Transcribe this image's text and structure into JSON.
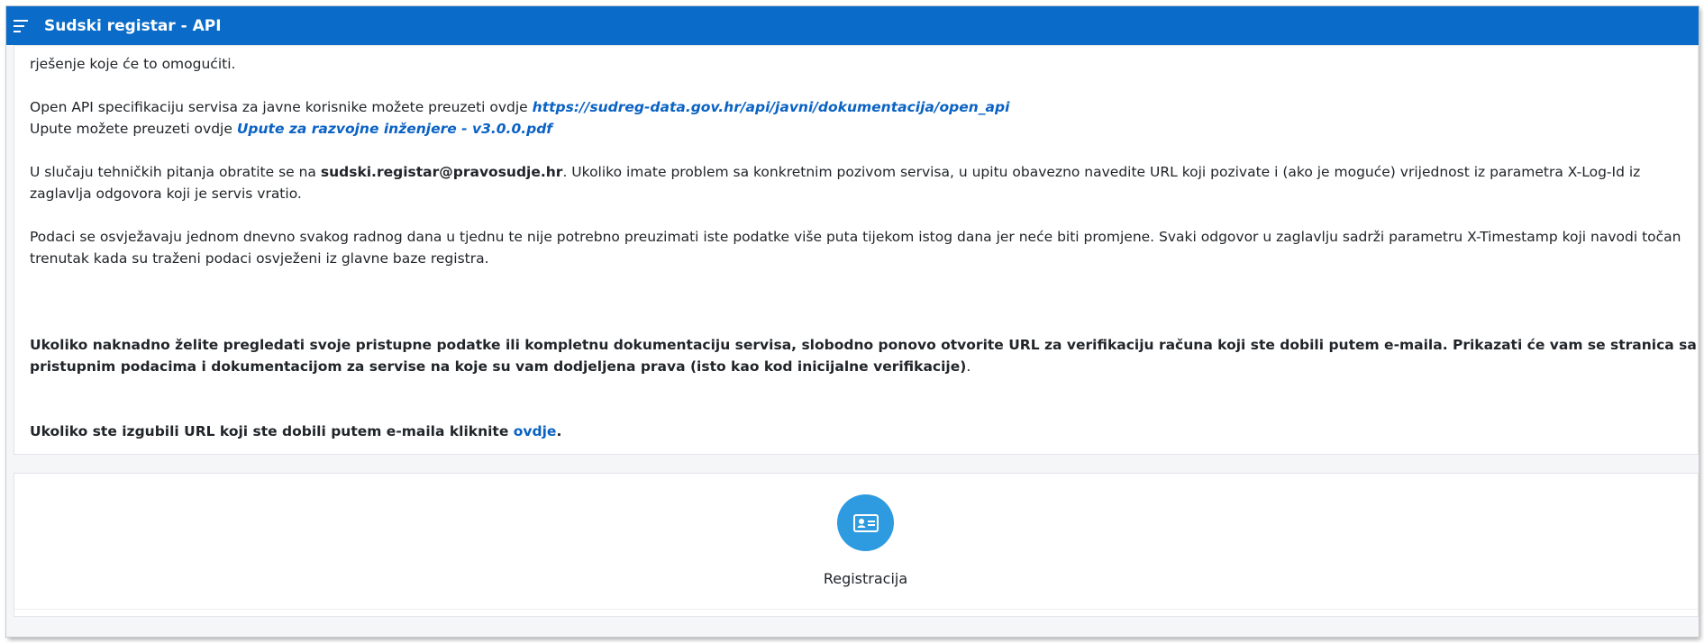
{
  "app": {
    "title": "Sudski registar - API",
    "menu_icon": "menu-icon"
  },
  "content": {
    "line_top": "rješenje koje će to omogućiti.",
    "openapi": {
      "prefix": "Open API specifikaciju servisa za javne korisnike možete preuzeti ovdje ",
      "link": "https://sudreg-data.gov.hr/api/javni/dokumentacija/open_api"
    },
    "upute": {
      "prefix": "Upute možete preuzeti ovdje ",
      "link": "Upute za razvojne inženjere - v3.0.0.pdf"
    },
    "tech": {
      "prefix": "U slučaju tehničkih pitanja obratite se na ",
      "email": "sudski.registar@pravosudje.hr",
      "suffix": ". Ukoliko imate problem sa konkretnim pozivom servisa, u upitu obavezno navedite URL koji pozivate i (ako je moguće) vrijednost iz parametra X-Log-Id iz zaglavlja odgovora koji je servis vratio."
    },
    "refresh": "Podaci se osvježavaju jednom dnevno svakog radnog dana u tjednu te nije potrebno preuzimati iste podatke više puta tijekom istog dana jer neće biti promjene. Svaki odgovor u zaglavlju sadrži parametru X-Timestamp koji navodi točan trenutak kada su traženi podaci osvježeni iz glavne baze registra.",
    "review": "Ukoliko naknadno želite pregledati svoje pristupne podatke ili kompletnu dokumentaciju servisa, slobodno ponovo otvorite URL za verifikaciju računa koji ste dobili putem e-maila. Prikazati će vam se stranica sa pristupnim podacima i dokumentacijom za servise na koje su vam dodjeljena prava (isto kao kod inicijalne verifikacije)",
    "review_end": ".",
    "lost": {
      "prefix": "Ukoliko ste izgubili URL koji ste dobili putem e-maila kliknite ",
      "link": "ovdje",
      "suffix": "."
    }
  },
  "registration": {
    "label": "Registracija",
    "icon": "id-card-icon",
    "color": "#2e9be0"
  },
  "colors": {
    "topbar": "#0a6cc8",
    "link": "#0a62c4"
  }
}
